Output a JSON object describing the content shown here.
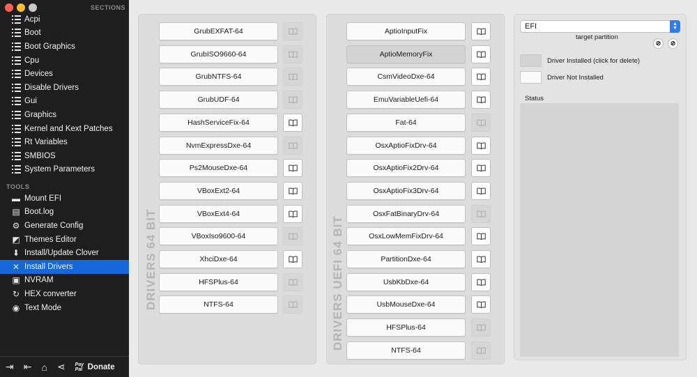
{
  "sidebar": {
    "sections_header": "SECTIONS",
    "tools_header": "TOOLS",
    "sections": [
      {
        "label": "Acpi",
        "icon": "list-icon"
      },
      {
        "label": "Boot",
        "icon": "list-icon"
      },
      {
        "label": "Boot Graphics",
        "icon": "list-icon"
      },
      {
        "label": "Cpu",
        "icon": "list-icon"
      },
      {
        "label": "Devices",
        "icon": "list-icon"
      },
      {
        "label": "Disable Drivers",
        "icon": "list-icon"
      },
      {
        "label": "Gui",
        "icon": "list-icon"
      },
      {
        "label": "Graphics",
        "icon": "list-icon"
      },
      {
        "label": "Kernel and Kext Patches",
        "icon": "list-icon"
      },
      {
        "label": "Rt Variables",
        "icon": "list-icon"
      },
      {
        "label": "SMBIOS",
        "icon": "list-icon"
      },
      {
        "label": "System Parameters",
        "icon": "list-icon"
      }
    ],
    "tools": [
      {
        "label": "Mount EFI",
        "icon": "disk-icon",
        "glyph": "▬"
      },
      {
        "label": "Boot.log",
        "icon": "document-icon",
        "glyph": "▤"
      },
      {
        "label": "Generate Config",
        "icon": "gear-icon",
        "glyph": "⚙"
      },
      {
        "label": "Themes Editor",
        "icon": "themes-icon",
        "glyph": "◩"
      },
      {
        "label": "Install/Update Clover",
        "icon": "download-icon",
        "glyph": "⬇"
      },
      {
        "label": "Install Drivers",
        "icon": "tools-icon",
        "glyph": "✕"
      },
      {
        "label": "NVRAM",
        "icon": "chip-icon",
        "glyph": "▣"
      },
      {
        "label": "HEX converter",
        "icon": "refresh-icon",
        "glyph": "↻"
      },
      {
        "label": "Text Mode",
        "icon": "eye-icon",
        "glyph": "◉"
      }
    ],
    "active_tool": "Install Drivers",
    "bottom": {
      "donate_label": "Donate",
      "paypal_text": "Pay Pal",
      "icons": [
        {
          "name": "sign-in-icon",
          "glyph": "⇥"
        },
        {
          "name": "sign-out-icon",
          "glyph": "⇤"
        },
        {
          "name": "home-icon",
          "glyph": "⌂"
        },
        {
          "name": "share-icon",
          "glyph": "⋖"
        }
      ]
    }
  },
  "drivers64": {
    "title": "DRIVERS 64 BIT",
    "items": [
      {
        "label": "GrubEXFAT-64",
        "info": false
      },
      {
        "label": "GrubISO9660-64",
        "info": false
      },
      {
        "label": "GrubNTFS-64",
        "info": false
      },
      {
        "label": "GrubUDF-64",
        "info": false
      },
      {
        "label": "HashServiceFix-64",
        "info": true
      },
      {
        "label": "NvmExpressDxe-64",
        "info": false
      },
      {
        "label": "Ps2MouseDxe-64",
        "info": true
      },
      {
        "label": "VBoxExt2-64",
        "info": true
      },
      {
        "label": "VBoxExt4-64",
        "info": true
      },
      {
        "label": "VBoxIso9600-64",
        "info": false
      },
      {
        "label": "XhciDxe-64",
        "info": true
      },
      {
        "label": "HFSPlus-64",
        "info": false
      },
      {
        "label": "NTFS-64",
        "info": false
      }
    ]
  },
  "driversUefi": {
    "title": "DRIVERS UEFI 64 BIT",
    "items": [
      {
        "label": "AptioInputFix",
        "info": true,
        "installed": false
      },
      {
        "label": "AptioMemoryFix",
        "info": true,
        "installed": true
      },
      {
        "label": "CsmVideoDxe-64",
        "info": true,
        "installed": false
      },
      {
        "label": "EmuVariableUefi-64",
        "info": true,
        "installed": false
      },
      {
        "label": "Fat-64",
        "info": false,
        "installed": false
      },
      {
        "label": "OsxAptioFixDrv-64",
        "info": true,
        "installed": false
      },
      {
        "label": "OsxAptioFix2Drv-64",
        "info": true,
        "installed": false
      },
      {
        "label": "OsxAptioFix3Drv-64",
        "info": true,
        "installed": false
      },
      {
        "label": "OsxFatBinaryDrv-64",
        "info": false,
        "installed": false
      },
      {
        "label": "OsxLowMemFixDrv-64",
        "info": true,
        "installed": false
      },
      {
        "label": "PartitionDxe-64",
        "info": true,
        "installed": false
      },
      {
        "label": "UsbKbDxe-64",
        "info": true,
        "installed": false
      },
      {
        "label": "UsbMouseDxe-64",
        "info": true,
        "installed": false
      },
      {
        "label": "HFSPlus-64",
        "info": false,
        "installed": false
      },
      {
        "label": "NTFS-64",
        "info": false,
        "installed": false
      }
    ]
  },
  "right_panel": {
    "partition_value": "EFI",
    "partition_label": "target partition",
    "legend_installed": "Driver Installed (click for delete)",
    "legend_not_installed": "Driver Not Installed",
    "status_label": "Status",
    "circle_button_1": "⊘",
    "circle_button_2": "⊘"
  },
  "colors": {
    "sidebar_bg": "#1e1e1e",
    "active_item": "#1668d6",
    "select_arrow": "#2c7ef6",
    "traffic_red": "#fe5f57",
    "traffic_yellow": "#febc2e",
    "traffic_gray": "#c8c8c8"
  }
}
